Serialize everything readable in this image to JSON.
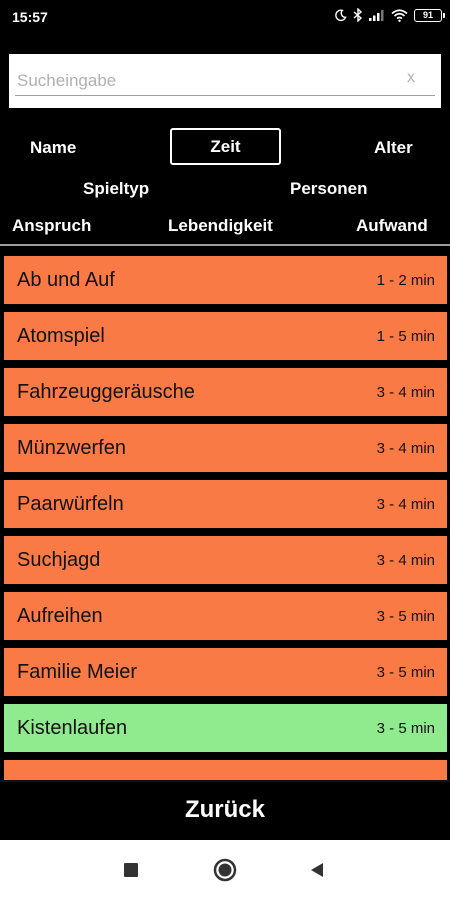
{
  "status_bar": {
    "time": "15:57",
    "battery": "91",
    "icons": [
      "moon-icon",
      "bluetooth-icon",
      "signal-icon",
      "wifi-icon",
      "battery-icon"
    ]
  },
  "search": {
    "placeholder": "Sucheingabe",
    "value": "",
    "clear_label": "x"
  },
  "sort_options": {
    "name": "Name",
    "zeit": "Zeit",
    "alter": "Alter",
    "spieltyp": "Spieltyp",
    "personen": "Personen",
    "anspruch": "Anspruch",
    "lebendigkeit": "Lebendigkeit",
    "aufwand": "Aufwand",
    "selected": "Zeit"
  },
  "games": [
    {
      "name": "Ab und Auf",
      "time": "1 - 2 min"
    },
    {
      "name": "Atomspiel",
      "time": "1 - 5 min"
    },
    {
      "name": "Fahrzeuggeräusche",
      "time": "3 - 4 min"
    },
    {
      "name": "Münzwerfen",
      "time": "3 - 4 min"
    },
    {
      "name": "Paarwürfeln",
      "time": "3 - 4 min"
    },
    {
      "name": "Suchjagd",
      "time": "3 - 4 min"
    },
    {
      "name": "Aufreihen",
      "time": "3 - 5 min"
    },
    {
      "name": "Familie Meier",
      "time": "3 - 5 min"
    },
    {
      "name": "Kistenlaufen",
      "time": "3 - 5 min",
      "highlighted": true
    }
  ],
  "colors": {
    "item_default": "#f97a44",
    "item_highlight": "#90ea8e",
    "background": "#000000"
  },
  "back_button": {
    "label": "Zurück"
  },
  "nav_bar": {
    "buttons": [
      "recents-square-icon",
      "home-circle-icon",
      "back-triangle-icon"
    ]
  }
}
